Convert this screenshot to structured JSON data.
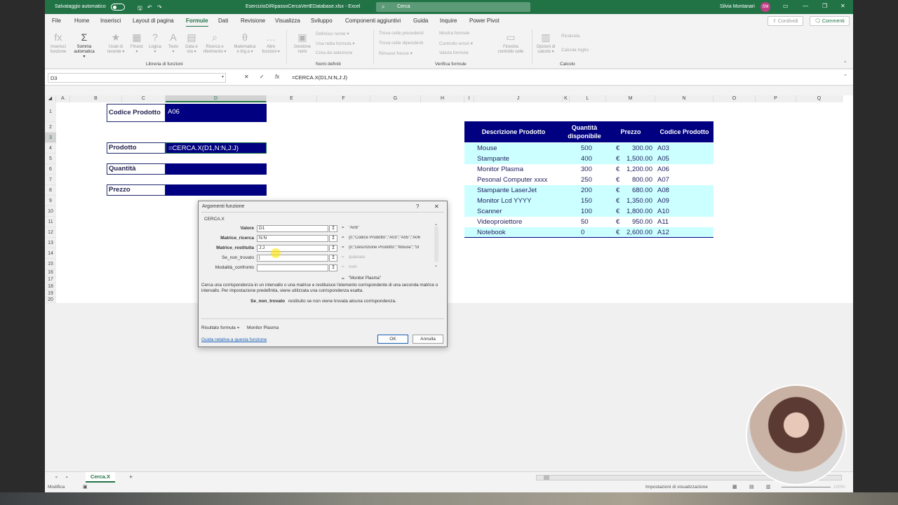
{
  "titlebar": {
    "autosave": "Salvataggio automatico",
    "filename": "EsercizioDiRipassoCercaVertEDatabase.xlsx - Excel",
    "search": "Cerca",
    "user": "Silvia Montanari",
    "initials": "SM"
  },
  "menu": [
    "File",
    "Home",
    "Inserisci",
    "Layout di pagina",
    "Formule",
    "Dati",
    "Revisione",
    "Visualizza",
    "Sviluppo",
    "Componenti aggiuntivi",
    "Guida",
    "Inquire",
    "Power Pivot"
  ],
  "topbuttons": {
    "share": "Condividi",
    "comments": "Commenti"
  },
  "ribbon": {
    "big": [
      {
        "icon": "fx",
        "l1": "Inserisci",
        "l2": "funzione"
      },
      {
        "icon": "Σ",
        "l1": "Somma",
        "l2": "automatica ▾"
      },
      {
        "icon": "★",
        "l1": "Usati di",
        "l2": "recente ▾"
      },
      {
        "icon": "▦",
        "l1": "Finanz",
        "l2": "▾"
      },
      {
        "icon": "?",
        "l1": "Logica",
        "l2": "▾"
      },
      {
        "icon": "A",
        "l1": "Testo",
        "l2": "▾"
      },
      {
        "icon": "▤",
        "l1": "Data e",
        "l2": "ora ▾"
      },
      {
        "icon": "⌕",
        "l1": "Ricerca e",
        "l2": "riferimento ▾"
      },
      {
        "icon": "θ",
        "l1": "Matematica",
        "l2": "e trig.a ▾"
      },
      {
        "icon": "…",
        "l1": "Altre",
        "l2": "funzioni ▾"
      },
      {
        "icon": "▣",
        "l1": "Gestione",
        "l2": "nomi"
      },
      {
        "icon": "▭",
        "l1": "Finestra",
        "l2": "controllo celle"
      },
      {
        "icon": "▥",
        "l1": "Opzioni di",
        "l2": "calcolo ▾"
      }
    ],
    "small": {
      "definisci": "Definisci nome ▾",
      "usa": "Usa nella formula ▾",
      "crea": "Crea da selezione",
      "prec": "Trova celle precedenti",
      "dip": "Trova celle dipendenti",
      "rim": "Rimuovi frecce ▾",
      "mostra": "Mostra formule",
      "controllo": "Controllo errori ▾",
      "valuta": "Valuta formula",
      "ricalcola": "Ricalcola",
      "calcfoglio": "Calcola foglio"
    },
    "groups": {
      "libreria": "Libreria di funzioni",
      "nomi": "Nomi definiti",
      "verifica": "Verifica formule",
      "calcolo": "Calcolo"
    }
  },
  "formulabar": {
    "namebox": "D3",
    "cancel": "✕",
    "enter": "✓",
    "fx": "fx",
    "formula": "=CERCA.X(D1,N:N,J:J)"
  },
  "columns": [
    "A",
    "B",
    "C",
    "D",
    "E",
    "F",
    "G",
    "H",
    "I",
    "J",
    "K",
    "L",
    "M",
    "N",
    "O",
    "P",
    "Q"
  ],
  "rows": [
    "1",
    "2",
    "3",
    "4",
    "5",
    "6",
    "7",
    "8",
    "9",
    "10",
    "11",
    "12",
    "13",
    "14",
    "15",
    "16",
    "17",
    "18",
    "19",
    "20"
  ],
  "cells": {
    "codice_label": "Codice Prodotto",
    "codice_val": "A06",
    "prodotto_label": "Prodotto",
    "prodotto_val": "=CERCA.X(D1,N:N,J:J)",
    "quantita_label": "Quantità",
    "prezzo_label": "Prezzo"
  },
  "table": {
    "headers": [
      "Descrizione Prodotto",
      "Quantità disponibile",
      "Prezzo",
      "Codice Prodotto"
    ],
    "rows": [
      {
        "desc": "Mouse",
        "qty": "500",
        "cur": "€",
        "price": "300.00",
        "code": "A03"
      },
      {
        "desc": "Stampante",
        "qty": "400",
        "cur": "€",
        "price": "1,500.00",
        "code": "A05"
      },
      {
        "desc": "Monitor Plasma",
        "qty": "300",
        "cur": "€",
        "price": "1,200.00",
        "code": "A06"
      },
      {
        "desc": "Pesonal Computer xxxx",
        "qty": "250",
        "cur": "€",
        "price": "800.00",
        "code": "A07"
      },
      {
        "desc": "Stampante LaserJet",
        "qty": "200",
        "cur": "€",
        "price": "680.00",
        "code": "A08"
      },
      {
        "desc": "Monitor Lcd YYYY",
        "qty": "150",
        "cur": "€",
        "price": "1,350.00",
        "code": "A09"
      },
      {
        "desc": "Scanner",
        "qty": "100",
        "cur": "€",
        "price": "1,800.00",
        "code": "A10"
      },
      {
        "desc": "Videoproiettore",
        "qty": "50",
        "cur": "€",
        "price": "950.00",
        "code": "A11"
      },
      {
        "desc": "Notebook",
        "qty": "0",
        "cur": "€",
        "price": "2,600.00",
        "code": "A12"
      }
    ]
  },
  "dialog": {
    "title": "Argomenti funzione",
    "help": "?",
    "close": "✕",
    "fn": "CERCA.X",
    "args": [
      {
        "label": "Valore",
        "bold": true,
        "value": "D1",
        "result": "\"A06\"",
        "dim": false
      },
      {
        "label": "Matrice_ricerca",
        "bold": true,
        "value": "N:N",
        "result": "{0;\"Codice Prodotto\";\"A03\";\"A05\";\"A06",
        "dim": false
      },
      {
        "label": "Matrice_restituita",
        "bold": true,
        "value": "J:J",
        "result": "{0;\"Descrizione Prodotto\";\"Mouse\";\"St",
        "dim": false
      },
      {
        "label": "Se_non_trovato",
        "bold": false,
        "value": "|",
        "result": "qualsiasi",
        "dim": true
      },
      {
        "label": "Modalità_confronto",
        "bold": false,
        "value": "",
        "result": "num",
        "dim": true
      }
    ],
    "eq": "=",
    "result_preview": "\"Monitor Plasma\"",
    "description": "Cerca una corrispondenza in un intervallo o una matrice e restituisce l'elemento corrispondente di una seconda matrice o intervallo. Per impostazione predefinita, viene utilizzata una corrispondenza esatta.",
    "arg_name": "Se_non_trovato",
    "arg_desc": "restituito se non viene trovata alcuna corrispondenza.",
    "result_label": "Risultato formula =",
    "result_value": "Monitor Plasma",
    "help_link": "Guida relativa a questa funzione",
    "ok": "OK",
    "cancel": "Annulla"
  },
  "sheet": {
    "tab": "Cerca.X",
    "add": "+"
  },
  "status": {
    "mode": "Modifica",
    "display": "Impostazioni di visualizzazione",
    "zoom": "100%"
  }
}
